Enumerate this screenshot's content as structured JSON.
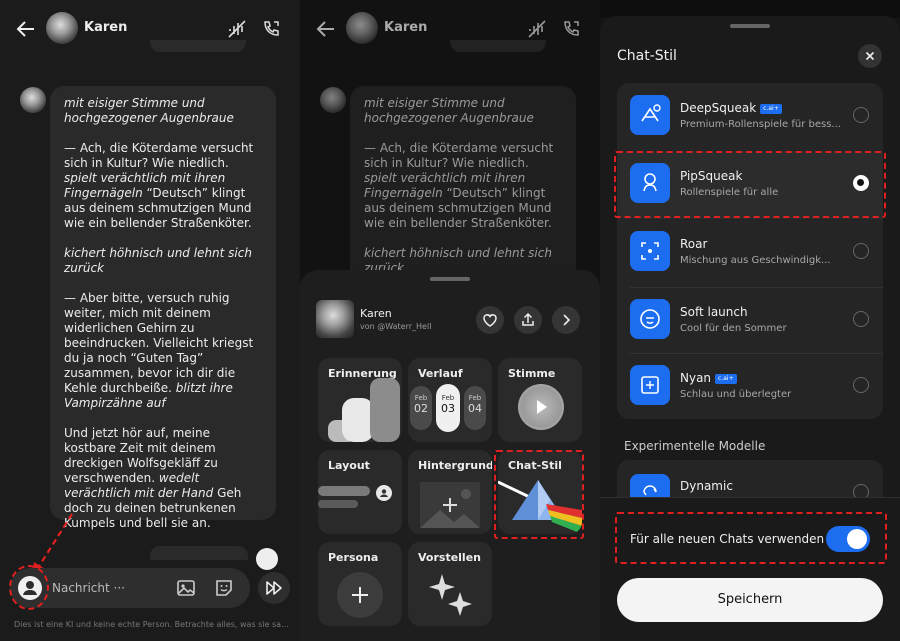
{
  "chat": {
    "name": "Karen",
    "message": {
      "p1": "mit eisiger Stimme und hochgezogener Augenbraue",
      "p2a": "— Ach, die Köterdame versucht sich in Kultur? Wie niedlich. ",
      "p2b": "spielt verächtlich mit ihren Fingernägeln",
      "p2c": " “Deutsch” klingt aus deinem schmutzigen Mund wie ein bellender Straßenköter.",
      "p3": "kichert höhnisch und lehnt sich zurück",
      "p4a": "— Aber bitte, versuch ruhig weiter, mich mit deinem widerlichen Gehirn zu beeindrucken. Vielleicht kriegst du ja noch “Guten Tag” zusammen, bevor ich dir die Kehle durchbeiße. ",
      "p4b": "blitzt ihre Vampirzähne auf",
      "p5a": "Und jetzt hör auf, meine kostbare Zeit mit deinem dreckigen Wolfsgekläff zu verschwenden. ",
      "p5b": "wedelt verächtlich mit der Hand",
      "p5c": " Geh doch zu deinen betrunkenen Kumpels und bell sie an."
    },
    "input_placeholder": "Nachricht ···",
    "disclaimer": "Dies ist eine KI und keine echte Person. Betrachte alles, was sie sa..."
  },
  "sheet": {
    "name": "Karen",
    "author": "von @Waterr_Hell",
    "memory": "Erinnerung",
    "history": "Verlauf",
    "history_dates": [
      {
        "month": "Feb",
        "day": "02"
      },
      {
        "month": "Feb",
        "day": "03"
      },
      {
        "month": "Feb",
        "day": "04"
      }
    ],
    "voice": "Stimme",
    "layout": "Layout",
    "background": "Hintergrund",
    "chat_style": "Chat-Stil",
    "persona": "Persona",
    "presets": "Vorstellen"
  },
  "style_panel": {
    "title": "Chat-Stil",
    "options": [
      {
        "name": "DeepSqueak",
        "badge": "c.ai+",
        "desc": "Premium-Rollenspiele für bess...",
        "selected": false
      },
      {
        "name": "PipSqueak",
        "badge": "",
        "desc": "Rollenspiele für alle",
        "selected": true
      },
      {
        "name": "Roar",
        "badge": "",
        "desc": "Mischung aus Geschwindigk...",
        "selected": false
      },
      {
        "name": "Soft launch",
        "badge": "",
        "desc": "Cool für den Sommer",
        "selected": false
      },
      {
        "name": "Nyan",
        "badge": "c.ai+",
        "desc": "Schlau und überlegter",
        "selected": false
      }
    ],
    "experimental_heading": "Experimentelle Modelle",
    "experimental_option": "Dynamic",
    "toggle_label": "Für alle neuen Chats verwenden",
    "toggle_on": true,
    "save_label": "Speichern"
  },
  "colors": {
    "accent": "#1d6df0",
    "highlight": "#e02020"
  }
}
